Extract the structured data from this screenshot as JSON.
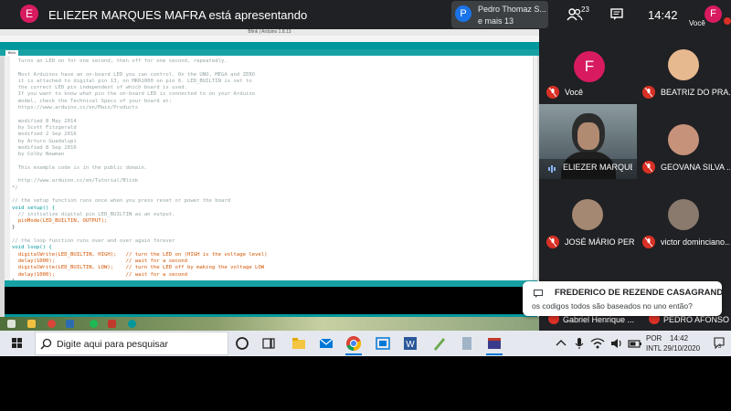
{
  "meet_topbar": {
    "presenter_initial": "E",
    "presenting_text": "ELIEZER MARQUES MAFRA está apresentando",
    "notification": {
      "initial": "P",
      "line1": "Pedro Thomaz S...",
      "line2": "e mais 13"
    },
    "people_count": "23",
    "time": "14:42",
    "self_initial": "F",
    "self_label": "Você"
  },
  "shared_screen": {
    "ide_title": "Blink | Arduino 1.8.13",
    "menu": [
      "File",
      "Edit",
      "Sketch",
      "Tools",
      "Help"
    ],
    "tab_label": "Blink",
    "code_lines": [
      {
        "t": "  Turns an LED on for one second, then off for one second, repeatedly.",
        "c": "cm"
      },
      {
        "t": "",
        "c": "cm"
      },
      {
        "t": "  Most Arduinos have an on-board LED you can control. On the UNO, MEGA and ZERO",
        "c": "cm"
      },
      {
        "t": "  it is attached to digital pin 13, on MKR1000 on pin 6. LED_BUILTIN is set to",
        "c": "cm"
      },
      {
        "t": "  the correct LED pin independent of which board is used.",
        "c": "cm"
      },
      {
        "t": "  If you want to know what pin the on-board LED is connected to on your Arduino",
        "c": "cm"
      },
      {
        "t": "  model, check the Technical Specs of your board at:",
        "c": "cm"
      },
      {
        "t": "  https://www.arduino.cc/en/Main/Products",
        "c": "cm"
      },
      {
        "t": "",
        "c": "cm"
      },
      {
        "t": "  modified 8 May 2014",
        "c": "cm"
      },
      {
        "t": "  by Scott Fitzgerald",
        "c": "cm"
      },
      {
        "t": "  modified 2 Sep 2016",
        "c": "cm"
      },
      {
        "t": "  by Arturo Guadalupi",
        "c": "cm"
      },
      {
        "t": "  modified 8 Sep 2016",
        "c": "cm"
      },
      {
        "t": "  by Colby Newman",
        "c": "cm"
      },
      {
        "t": "",
        "c": "cm"
      },
      {
        "t": "  This example code is in the public domain.",
        "c": "cm"
      },
      {
        "t": "",
        "c": "cm"
      },
      {
        "t": "  http://www.arduino.cc/en/Tutorial/Blink",
        "c": "cm"
      },
      {
        "t": "*/",
        "c": "cm"
      },
      {
        "t": "",
        "c": "cm"
      },
      {
        "t": "// the setup function runs once when you press reset or power the board",
        "c": "cm"
      },
      {
        "t": "void setup() {",
        "c": "kw"
      },
      {
        "t": "  // initialize digital pin LED_BUILTIN as an output.",
        "c": "cm"
      },
      {
        "t": "  pinMode(LED_BUILTIN, OUTPUT);",
        "c": "fn"
      },
      {
        "t": "}",
        "c": ""
      },
      {
        "t": "",
        "c": ""
      },
      {
        "t": "// the loop function runs over and over again forever",
        "c": "cm"
      },
      {
        "t": "void loop() {",
        "c": "kw"
      },
      {
        "t": "  digitalWrite(LED_BUILTIN, HIGH);   // turn the LED on (HIGH is the voltage level)",
        "c": "fn"
      },
      {
        "t": "  delay(1000);                       // wait for a second",
        "c": "fn"
      },
      {
        "t": "  digitalWrite(LED_BUILTIN, LOW);    // turn the LED off by making the voltage LOW",
        "c": "fn"
      },
      {
        "t": "  delay(1000);                       // wait for a second",
        "c": "fn"
      },
      {
        "t": "}",
        "c": ""
      }
    ]
  },
  "participants": [
    {
      "name": "Você",
      "initial": "F",
      "muted": true
    },
    {
      "name": "BEATRIZ DO PRA...",
      "muted": true
    },
    {
      "name": "ELIEZER MARQUE...",
      "muted": false,
      "speaking": true
    },
    {
      "name": "GEOVANA SILVA ...",
      "muted": true
    },
    {
      "name": "JOSÉ MÁRIO PER...",
      "muted": true
    },
    {
      "name": "victor dominciano...",
      "muted": true
    },
    {
      "name": "Gabriel Henrique ...",
      "muted": true
    },
    {
      "name": "PEDRO AFONSO ...",
      "muted": true
    }
  ],
  "chat_toast": {
    "sender": "FREDERICO DE REZENDE CASAGRANDE",
    "message": "os codigos todos são baseados no uno então?"
  },
  "windows_taskbar": {
    "search_placeholder": "Digite aqui para pesquisar",
    "lang1": "POR",
    "lang2": "INTL",
    "time": "14:42",
    "date": "29/10/2020",
    "notification_count": "3"
  },
  "colors": {
    "meet_dark": "#202124",
    "arduino_teal": "#00979c",
    "avatar_pink": "#d81b60",
    "muted_red": "#d93025"
  }
}
